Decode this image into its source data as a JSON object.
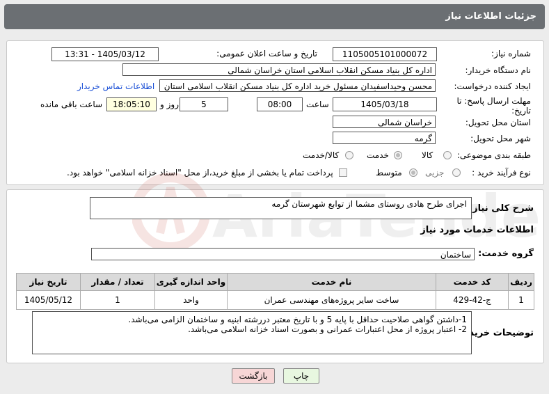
{
  "title": "جزئیات اطلاعات نیاز",
  "watermark": "AriaTender.net",
  "need_number": {
    "label": "شماره نیاز:",
    "value": "1105005101000072"
  },
  "announce": {
    "label": "تاریخ و ساعت اعلان عمومی:",
    "value": "1405/03/12 - 13:31"
  },
  "buyer_org": {
    "label": "نام دستگاه خریدار:",
    "value": "اداره کل بنیاد مسکن انقلاب اسلامی استان خراسان شمالی"
  },
  "requester": {
    "label": "ایجاد کننده درخواست:",
    "value": "محسن وحیداسفیدان مسئول خرید اداره کل بنیاد مسکن انقلاب اسلامی استان",
    "contact_link": "اطلاعات تماس خریدار"
  },
  "deadline": {
    "label": "مهلت ارسال پاسخ: تا تاریخ:",
    "date": "1405/03/18",
    "time_label": "ساعت",
    "time": "08:00",
    "days": "5",
    "days_label": "روز و",
    "remaining": "18:05:10",
    "remaining_label": "ساعت باقی مانده"
  },
  "province": {
    "label": "استان محل تحویل:",
    "value": "خراسان شمالی"
  },
  "city": {
    "label": "شهر محل تحویل:",
    "value": "گرمه"
  },
  "category": {
    "label": "طبقه بندی موضوعی:",
    "options": [
      "کالا",
      "خدمت",
      "کالا/خدمت"
    ],
    "selected": "خدمت"
  },
  "purchase_type": {
    "label": "نوع فرآیند خرید :",
    "options": [
      "جزیی",
      "متوسط"
    ],
    "selected": "متوسط",
    "note": "پرداخت تمام یا بخشی از مبلغ خرید،از محل \"اسناد خزانه اسلامی\" خواهد بود."
  },
  "summary": {
    "label": "شرح کلی نیاز:",
    "value": "اجرای طرح هادی روستای مشما از توابع شهرستان گرمه"
  },
  "services_heading": "اطلاعات خدمات مورد نیاز",
  "service_group": {
    "label": "گروه خدمت:",
    "value": "ساختمان"
  },
  "table": {
    "headers": [
      "ردیف",
      "کد خدمت",
      "نام خدمت",
      "واحد اندازه گیری",
      "تعداد / مقدار",
      "تاریخ نیاز"
    ],
    "rows": [
      [
        "1",
        "ج-42-429",
        "ساخت سایر پروژه‌های مهندسی عمران",
        "واحد",
        "1",
        "1405/05/12"
      ]
    ]
  },
  "buyer_notes": {
    "label": "توضیحات خریدار:",
    "lines": [
      "1-داشتن گواهی صلاحیت حداقل با پایه 5 و با تاریخ معتبر دررشته ابنیه و ساختمان الزامی می‌باشد.",
      "2- اعتبار پروژه از محل اعتبارات عمرانی و بصورت اسناد خزانه اسلامی می‌باشد."
    ]
  },
  "buttons": {
    "print": "چاپ",
    "back": "بازگشت"
  },
  "colors": {
    "titlebar": "#6b6f73",
    "back_button": "#f7d6d6",
    "print_button": "#e8f7e0",
    "link": "#1a4fd6"
  }
}
